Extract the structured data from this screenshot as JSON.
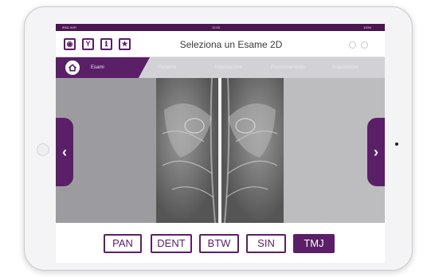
{
  "statusbar": {
    "left": "iPAD WiFi",
    "center": "12:00",
    "right": "100%"
  },
  "header": {
    "title": "Seleziona un Esame 2D",
    "tool_icons": [
      "eye-icon",
      "patient-icon",
      "info-icon",
      "star-icon"
    ],
    "tool_glyphs": [
      "◉",
      "Y",
      "ℹ",
      "★"
    ]
  },
  "tabs": [
    {
      "label": "Esami",
      "active": true
    },
    {
      "label": "Paziente",
      "active": false
    },
    {
      "label": "Impostazioni",
      "active": false
    },
    {
      "label": "Posizionamento",
      "active": false
    },
    {
      "label": "Acquisizione",
      "active": false
    }
  ],
  "nav": {
    "prev_glyph": "‹",
    "next_glyph": "›"
  },
  "exams": [
    {
      "label": "PAN",
      "active": false
    },
    {
      "label": "DENT",
      "active": false
    },
    {
      "label": "BTW",
      "active": false
    },
    {
      "label": "SIN",
      "active": false
    },
    {
      "label": "TMJ",
      "active": true
    }
  ],
  "colors": {
    "accent": "#5a1f66",
    "tabbar": "#d2d2d6",
    "viewer": "#9c9ca0"
  }
}
